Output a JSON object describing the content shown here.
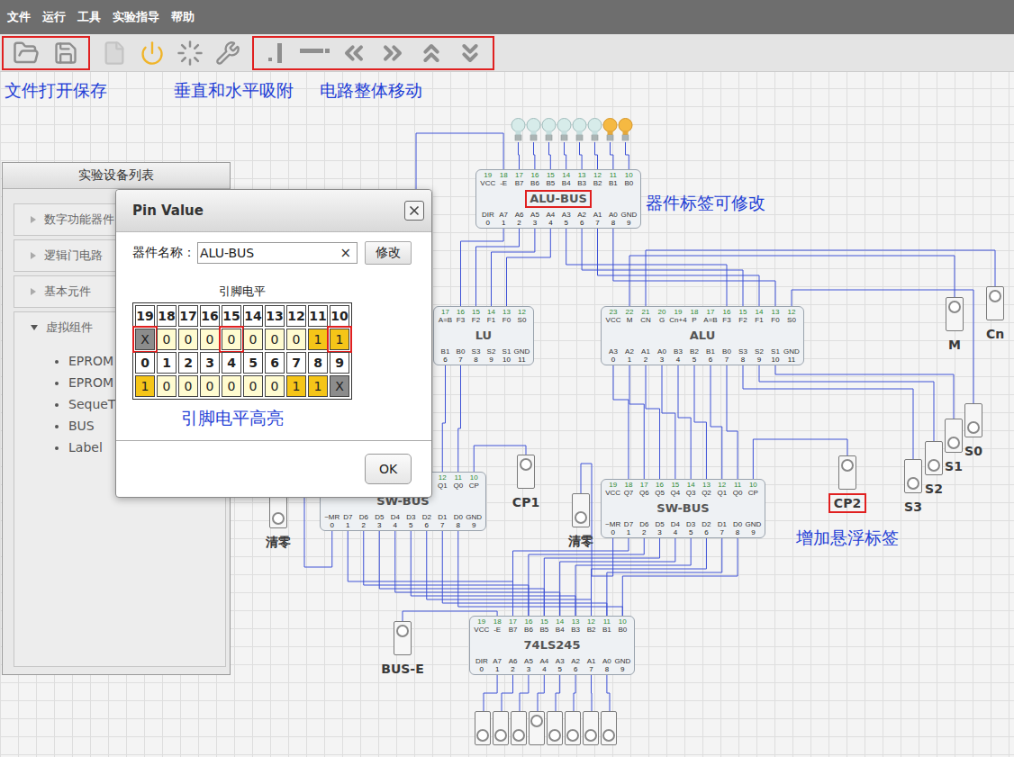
{
  "menu": [
    "文件",
    "运行",
    "工具",
    "实验指导",
    "帮助"
  ],
  "annotations": [
    "文件打开保存",
    "垂直和水平吸附",
    "电路整体移动",
    "器件标签可修改",
    "增加悬浮标签"
  ],
  "device_panel": {
    "title": "实验设备列表",
    "groups": [
      {
        "label": "数字功能器件",
        "expanded": false,
        "items": []
      },
      {
        "label": "逻辑门电路",
        "expanded": false,
        "items": []
      },
      {
        "label": "基本元件",
        "expanded": false,
        "items": []
      },
      {
        "label": "虚拟组件",
        "expanded": true,
        "items": [
          "EPROM",
          "EPROM",
          "SequeT",
          "BUS",
          "Label"
        ]
      }
    ]
  },
  "chips": [
    {
      "name": "ALU-BUS",
      "highlighted": true,
      "top_pins": [
        {
          "num": "19",
          "label": "VCC"
        },
        {
          "num": "18",
          "label": "-E"
        },
        {
          "num": "17",
          "label": "B7"
        },
        {
          "num": "16",
          "label": "B6"
        },
        {
          "num": "15",
          "label": "B5"
        },
        {
          "num": "14",
          "label": "B4"
        },
        {
          "num": "13",
          "label": "B3"
        },
        {
          "num": "12",
          "label": "B2"
        },
        {
          "num": "11",
          "label": "B1"
        },
        {
          "num": "10",
          "label": "B0"
        }
      ],
      "bottom_pins": [
        {
          "label": "DIR",
          "num": "0"
        },
        {
          "label": "A7",
          "num": "1"
        },
        {
          "label": "A6",
          "num": "2"
        },
        {
          "label": "A5",
          "num": "3"
        },
        {
          "label": "A4",
          "num": "4"
        },
        {
          "label": "A3",
          "num": "5"
        },
        {
          "label": "A2",
          "num": "6"
        },
        {
          "label": "A1",
          "num": "7"
        },
        {
          "label": "A0",
          "num": "8"
        },
        {
          "label": "GND",
          "num": "9"
        }
      ]
    },
    {
      "name": "LU",
      "highlighted": false,
      "top_pins": [
        {
          "num": "17",
          "label": "A=B"
        },
        {
          "num": "16",
          "label": "F3"
        },
        {
          "num": "15",
          "label": "F2"
        },
        {
          "num": "14",
          "label": "F1"
        },
        {
          "num": "13",
          "label": "F0"
        },
        {
          "num": "12",
          "label": "S0"
        }
      ],
      "bottom_pins": [
        {
          "label": "B1",
          "num": "6"
        },
        {
          "label": "B0",
          "num": "7"
        },
        {
          "label": "S3",
          "num": "8"
        },
        {
          "label": "S2",
          "num": "9"
        },
        {
          "label": "S1",
          "num": "10"
        },
        {
          "label": "GND",
          "num": "11"
        }
      ]
    },
    {
      "name": "ALU",
      "highlighted": false,
      "top_pins": [
        {
          "num": "23",
          "label": "VCC"
        },
        {
          "num": "22",
          "label": "M"
        },
        {
          "num": "21",
          "label": "CN"
        },
        {
          "num": "20",
          "label": "G"
        },
        {
          "num": "19",
          "label": "Cn+4"
        },
        {
          "num": "18",
          "label": "P"
        },
        {
          "num": "17",
          "label": "A=B"
        },
        {
          "num": "16",
          "label": "F3"
        },
        {
          "num": "15",
          "label": "F2"
        },
        {
          "num": "14",
          "label": "F1"
        },
        {
          "num": "13",
          "label": "F0"
        },
        {
          "num": "12",
          "label": "S0"
        }
      ],
      "bottom_pins": [
        {
          "label": "A3",
          "num": "0"
        },
        {
          "label": "A2",
          "num": "1"
        },
        {
          "label": "A1",
          "num": "2"
        },
        {
          "label": "A0",
          "num": "3"
        },
        {
          "label": "B3",
          "num": "4"
        },
        {
          "label": "B2",
          "num": "5"
        },
        {
          "label": "B1",
          "num": "6"
        },
        {
          "label": "B0",
          "num": "7"
        },
        {
          "label": "S3",
          "num": "8"
        },
        {
          "label": "S2",
          "num": "9"
        },
        {
          "label": "S1",
          "num": "10"
        },
        {
          "label": "GND",
          "num": "11"
        }
      ]
    },
    {
      "name": "SW-BUS",
      "highlighted": false,
      "top_pins": [
        {
          "num": "12",
          "label": "Q1"
        },
        {
          "num": "11",
          "label": "Q0"
        },
        {
          "num": "10",
          "label": "CP"
        }
      ],
      "bottom_pins": [
        {
          "label": "~MR",
          "num": "0"
        },
        {
          "label": "D7",
          "num": "1"
        },
        {
          "label": "D6",
          "num": "2"
        },
        {
          "label": "D5",
          "num": "3"
        },
        {
          "label": "D4",
          "num": "4"
        },
        {
          "label": "D3",
          "num": "5"
        },
        {
          "label": "D2",
          "num": "6"
        },
        {
          "label": "D1",
          "num": "7"
        },
        {
          "label": "D0",
          "num": "8"
        },
        {
          "label": "GND",
          "num": "9"
        }
      ]
    },
    {
      "name": "SW-BUS",
      "highlighted": false,
      "top_pins": [
        {
          "num": "19",
          "label": "VCC"
        },
        {
          "num": "18",
          "label": "Q7"
        },
        {
          "num": "17",
          "label": "Q6"
        },
        {
          "num": "16",
          "label": "Q5"
        },
        {
          "num": "15",
          "label": "Q4"
        },
        {
          "num": "14",
          "label": "Q3"
        },
        {
          "num": "13",
          "label": "Q2"
        },
        {
          "num": "12",
          "label": "Q1"
        },
        {
          "num": "11",
          "label": "Q0"
        },
        {
          "num": "10",
          "label": "CP"
        }
      ],
      "bottom_pins": [
        {
          "label": "~MR",
          "num": "0"
        },
        {
          "label": "D7",
          "num": "1"
        },
        {
          "label": "D6",
          "num": "2"
        },
        {
          "label": "D5",
          "num": "3"
        },
        {
          "label": "D4",
          "num": "4"
        },
        {
          "label": "D3",
          "num": "5"
        },
        {
          "label": "D2",
          "num": "6"
        },
        {
          "label": "D1",
          "num": "7"
        },
        {
          "label": "D0",
          "num": "8"
        },
        {
          "label": "GND",
          "num": "9"
        }
      ]
    },
    {
      "name": "74LS245",
      "highlighted": false,
      "top_pins": [
        {
          "num": "19",
          "label": "VCC"
        },
        {
          "num": "18",
          "label": "-E"
        },
        {
          "num": "17",
          "label": "B7"
        },
        {
          "num": "16",
          "label": "B6"
        },
        {
          "num": "15",
          "label": "B5"
        },
        {
          "num": "14",
          "label": "B4"
        },
        {
          "num": "13",
          "label": "B3"
        },
        {
          "num": "12",
          "label": "B2"
        },
        {
          "num": "11",
          "label": "B1"
        },
        {
          "num": "10",
          "label": "B0"
        }
      ],
      "bottom_pins": [
        {
          "label": "DIR",
          "num": "0"
        },
        {
          "label": "A7",
          "num": "1"
        },
        {
          "label": "A6",
          "num": "2"
        },
        {
          "label": "A5",
          "num": "3"
        },
        {
          "label": "A4",
          "num": "4"
        },
        {
          "label": "A3",
          "num": "5"
        },
        {
          "label": "A2",
          "num": "6"
        },
        {
          "label": "A1",
          "num": "7"
        },
        {
          "label": "A0",
          "num": "8"
        },
        {
          "label": "GND",
          "num": "9"
        }
      ]
    }
  ],
  "bulbs": [
    {
      "on": false
    },
    {
      "on": false
    },
    {
      "on": false
    },
    {
      "on": false
    },
    {
      "on": false
    },
    {
      "on": false
    },
    {
      "on": true
    },
    {
      "on": true
    }
  ],
  "switches": [
    {
      "label": "M",
      "on": true,
      "highlighted": false
    },
    {
      "label": "Cn",
      "on": true,
      "highlighted": false
    },
    {
      "label": "S0",
      "on": false,
      "highlighted": false
    },
    {
      "label": "S1",
      "on": false,
      "highlighted": false
    },
    {
      "label": "S2",
      "on": false,
      "highlighted": false
    },
    {
      "label": "S3",
      "on": false,
      "highlighted": false
    },
    {
      "label": "CP1",
      "on": true,
      "highlighted": false
    },
    {
      "label": "CP2",
      "on": true,
      "highlighted": true
    },
    {
      "label": "清零",
      "on": false,
      "highlighted": false
    },
    {
      "label": "清零",
      "on": false,
      "highlighted": false
    },
    {
      "label": "BUS-E",
      "on": true,
      "highlighted": false
    }
  ],
  "input_switches": [
    {
      "on": false
    },
    {
      "on": false
    },
    {
      "on": false
    },
    {
      "on": true
    },
    {
      "on": false
    },
    {
      "on": false
    },
    {
      "on": false
    },
    {
      "on": false
    }
  ],
  "dialog": {
    "title": "Pin Value",
    "name_label": "器件名称：",
    "name_value": "ALU-BUS",
    "clear": "×",
    "modify_button": "修改",
    "table_title": "引脚电平",
    "rows": [
      {
        "kind": "number",
        "cells": [
          {
            "text": "19"
          },
          {
            "text": "18"
          },
          {
            "text": "17"
          },
          {
            "text": "16"
          },
          {
            "text": "15"
          },
          {
            "text": "14"
          },
          {
            "text": "13"
          },
          {
            "text": "12"
          },
          {
            "text": "11"
          },
          {
            "text": "10"
          }
        ]
      },
      {
        "kind": "value",
        "cells": [
          {
            "text": "X",
            "color": "#8c8c8c",
            "highlighted": true
          },
          {
            "text": "0",
            "color": "#fffbd0",
            "highlighted": false
          },
          {
            "text": "0",
            "color": "#fffbd0",
            "highlighted": false
          },
          {
            "text": "0",
            "color": "#fffbd0",
            "highlighted": false
          },
          {
            "text": "0",
            "color": "#fffbd0",
            "highlighted": true
          },
          {
            "text": "0",
            "color": "#fffbd0",
            "highlighted": false
          },
          {
            "text": "0",
            "color": "#fffbd0",
            "highlighted": false
          },
          {
            "text": "0",
            "color": "#fffbd0",
            "highlighted": false
          },
          {
            "text": "1",
            "color": "#f5c518",
            "highlighted": false
          },
          {
            "text": "1",
            "color": "#f5c518",
            "highlighted": true
          }
        ]
      },
      {
        "kind": "number",
        "cells": [
          {
            "text": "0"
          },
          {
            "text": "1"
          },
          {
            "text": "2"
          },
          {
            "text": "3"
          },
          {
            "text": "4"
          },
          {
            "text": "5"
          },
          {
            "text": "6"
          },
          {
            "text": "7"
          },
          {
            "text": "8"
          },
          {
            "text": "9"
          }
        ]
      },
      {
        "kind": "value",
        "cells": [
          {
            "text": "1",
            "color": "#f5c518",
            "highlighted": false
          },
          {
            "text": "0",
            "color": "#fffbd0",
            "highlighted": false
          },
          {
            "text": "0",
            "color": "#fffbd0",
            "highlighted": false
          },
          {
            "text": "0",
            "color": "#fffbd0",
            "highlighted": false
          },
          {
            "text": "0",
            "color": "#fffbd0",
            "highlighted": false
          },
          {
            "text": "0",
            "color": "#fffbd0",
            "highlighted": false
          },
          {
            "text": "0",
            "color": "#fffbd0",
            "highlighted": false
          },
          {
            "text": "1",
            "color": "#f5c518",
            "highlighted": false
          },
          {
            "text": "1",
            "color": "#f5c518",
            "highlighted": false
          },
          {
            "text": "X",
            "color": "#8c8c8c",
            "highlighted": false
          }
        ]
      }
    ],
    "annotation": "引脚电平高亮",
    "ok_button": "OK"
  }
}
